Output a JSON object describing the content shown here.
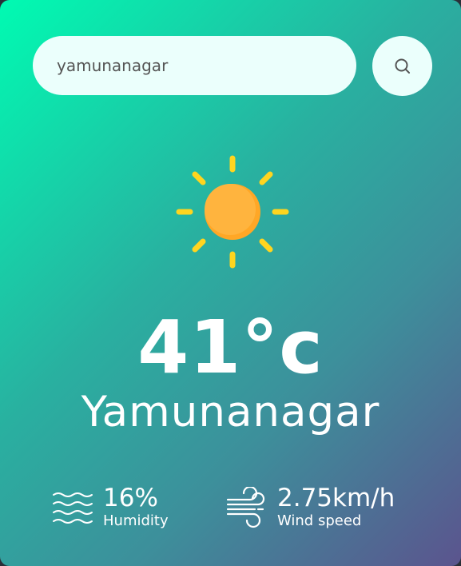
{
  "search": {
    "value": "yamunanagar",
    "icon": "search-icon"
  },
  "weather": {
    "condition_icon": "sun-icon",
    "temperature": "41°c",
    "city": "Yamunanagar"
  },
  "details": {
    "humidity": {
      "icon": "humidity-waves-icon",
      "value": "16%",
      "label": "Humidity"
    },
    "wind": {
      "icon": "wind-icon",
      "value": "2.75km/h",
      "label": "Wind speed"
    }
  },
  "colors": {
    "gradient_start": "#00fbb2",
    "gradient_end": "#5b548e",
    "input_bg": "#ebfffc",
    "sun_core": "#ffb03b",
    "sun_rays": "#ffd51f"
  }
}
